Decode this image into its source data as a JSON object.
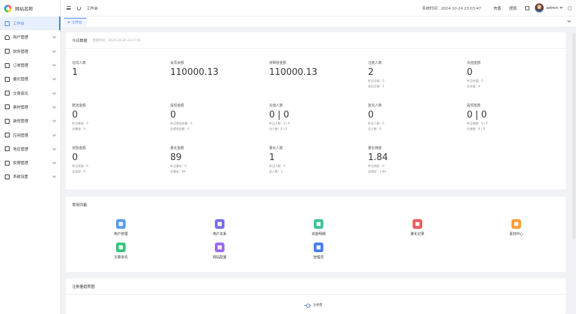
{
  "logo": {
    "name": "网站名称"
  },
  "sidebar": {
    "items": [
      {
        "label": "工作台",
        "icon": "monitor-icon",
        "active": true
      },
      {
        "label": "用户管理",
        "icon": "user-icon"
      },
      {
        "label": "财务管理",
        "icon": "finance-icon"
      },
      {
        "label": "订单管理",
        "icon": "order-icon"
      },
      {
        "label": "量化管理",
        "icon": "quant-icon"
      },
      {
        "label": "文章资讯",
        "icon": "article-icon"
      },
      {
        "label": "素材管理",
        "icon": "material-icon"
      },
      {
        "label": "装修管理",
        "icon": "decor-icon"
      },
      {
        "label": "应用管理",
        "icon": "app-icon"
      },
      {
        "label": "地区管理",
        "icon": "region-icon"
      },
      {
        "label": "权限管理",
        "icon": "permission-icon"
      },
      {
        "label": "系统设置",
        "icon": "settings-icon"
      }
    ]
  },
  "header": {
    "breadcrumb": "工作台",
    "system_time": "系统时间：2024-10-24 23:03:47",
    "recharge": "充值",
    "withdraw": "提现",
    "username": "admin"
  },
  "tabs": {
    "active": "工作台"
  },
  "today": {
    "title": "今日数据",
    "update_time": "更新时间：2024-10-24 23:17:01",
    "stats": [
      {
        "label": "在线人数",
        "value": "1",
        "subs": []
      },
      {
        "label": "会员余额",
        "value": "110000.13",
        "subs": []
      },
      {
        "label": "待释放金额",
        "value": "110000.13",
        "subs": []
      },
      {
        "label": "注册人数",
        "value": "2",
        "subs": [
          "昨日注册：0",
          "本日注册：2"
        ]
      },
      {
        "label": "充值金额",
        "value": "0",
        "subs": [
          "昨日充值：0",
          "总充值：0"
        ]
      },
      {
        "label": "赠送金额",
        "value": "0",
        "subs": [
          "昨日赠送：0",
          "总赠送：0"
        ]
      },
      {
        "label": "提现金额",
        "value": "0",
        "subs": [
          "昨日提现金额：0",
          "总提现金额：0"
        ]
      },
      {
        "label": "充值人数",
        "value": "0 | 0",
        "subs": [
          "昨日人数：0 | 0",
          "总人数：0 | 0"
        ]
      },
      {
        "label": "首充人数",
        "value": "0",
        "subs": [
          "昨日人数：0",
          "总人数：0"
        ]
      },
      {
        "label": "提现笔数",
        "value": "0 | 0",
        "subs": [
          "昨日笔数：0 | 0",
          "总笔数：0 | 0"
        ]
      },
      {
        "label": "奖励金额",
        "value": "0",
        "subs": [
          "昨日奖励：0",
          "总奖励：0"
        ]
      },
      {
        "label": "量化金额",
        "value": "89",
        "subs": [
          "昨日量化：0",
          "总量化：89"
        ]
      },
      {
        "label": "量化人数",
        "value": "1",
        "subs": [
          "昨日人数：0",
          "总人数：1"
        ]
      },
      {
        "label": "量化佣金",
        "value": "1.84",
        "subs": [
          "昨日佣金：0",
          "总佣金：1.84"
        ]
      }
    ]
  },
  "functions": {
    "title": "常用功能",
    "items": [
      {
        "label": "用户管理",
        "icon": "user-icon",
        "color": "#5b9cf2"
      },
      {
        "label": "用户关系",
        "icon": "relation-icon",
        "color": "#7b6ff0"
      },
      {
        "label": "资金明细",
        "icon": "fund-detail-icon",
        "color": "#3cc59b"
      },
      {
        "label": "量化记录",
        "icon": "quant-record-icon",
        "color": "#f05b5b"
      },
      {
        "label": "素材中心",
        "icon": "material-center-icon",
        "color": "#f7a03c"
      },
      {
        "label": "文章资讯",
        "icon": "article-icon",
        "color": "#3cc57a"
      },
      {
        "label": "网站配置",
        "icon": "site-config-icon",
        "color": "#9b6bf0"
      },
      {
        "label": "管理员",
        "icon": "admin-icon",
        "color": "#4a7cf6"
      }
    ]
  },
  "chart_section": {
    "title": "注册量趋势图",
    "legend": "注册量"
  }
}
